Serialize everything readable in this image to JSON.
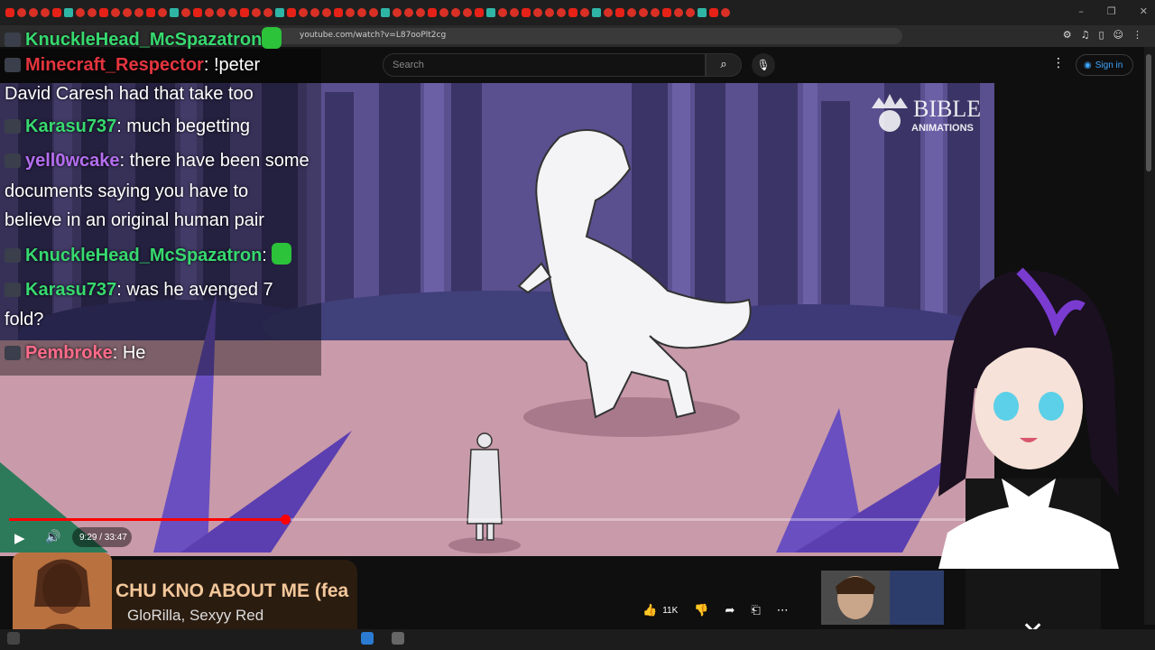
{
  "browser": {
    "url": "youtube.com/watch?v=L87ooPlt2cg",
    "window_controls": [
      "–",
      "❐",
      "✕"
    ]
  },
  "youtube": {
    "search_placeholder": "Search",
    "search_icon": "search-icon",
    "mic_icon": "mic-icon",
    "signin_label": "Sign in",
    "watermark_line1": "BIBLE",
    "watermark_line2": "ANIMATIONS"
  },
  "player": {
    "time": "9:29 / 33:47",
    "progress_fraction": 0.281
  },
  "chat": {
    "messages": [
      {
        "user": "KnuckleHead_McSpazatron",
        "user_color": "#37d96f",
        "text": "",
        "emote": true
      },
      {
        "user": "Minecraft_Respector",
        "user_color": "#e5353f",
        "text": ": !peter"
      },
      {
        "user": "",
        "user_color": "#ffffff",
        "text": "David Caresh had that take too"
      },
      {
        "user": "Karasu737",
        "user_color": "#37d96f",
        "text": ": much begetting"
      },
      {
        "user": "yell0wcake",
        "user_color": "#b46ef0",
        "text": ": there have been some"
      },
      {
        "user": "",
        "user_color": "#ffffff",
        "text": "documents saying you have to"
      },
      {
        "user": "",
        "user_color": "#ffffff",
        "text": "believe in an original human pair"
      },
      {
        "user": "KnuckleHead_McSpazatron",
        "user_color": "#37d96f",
        "text": ": ",
        "emote": true
      },
      {
        "user": "Karasu737",
        "user_color": "#37d96f",
        "text": ": was he avenged 7"
      },
      {
        "user": "",
        "user_color": "#ffffff",
        "text": "fold?"
      },
      {
        "user": "Pembroke",
        "user_color": "#ff6b8a",
        "text": ": He"
      }
    ]
  },
  "now_playing": {
    "title": "CHU KNO ABOUT ME (fea",
    "artist": "GloRilla, Sexyy Red"
  },
  "actions": {
    "likes": "11K"
  },
  "colors": {
    "accent_red": "#ff0000",
    "link_blue": "#3ea6ff",
    "forest_dark": "#3b3466",
    "ground_pink": "#c99aa9"
  }
}
